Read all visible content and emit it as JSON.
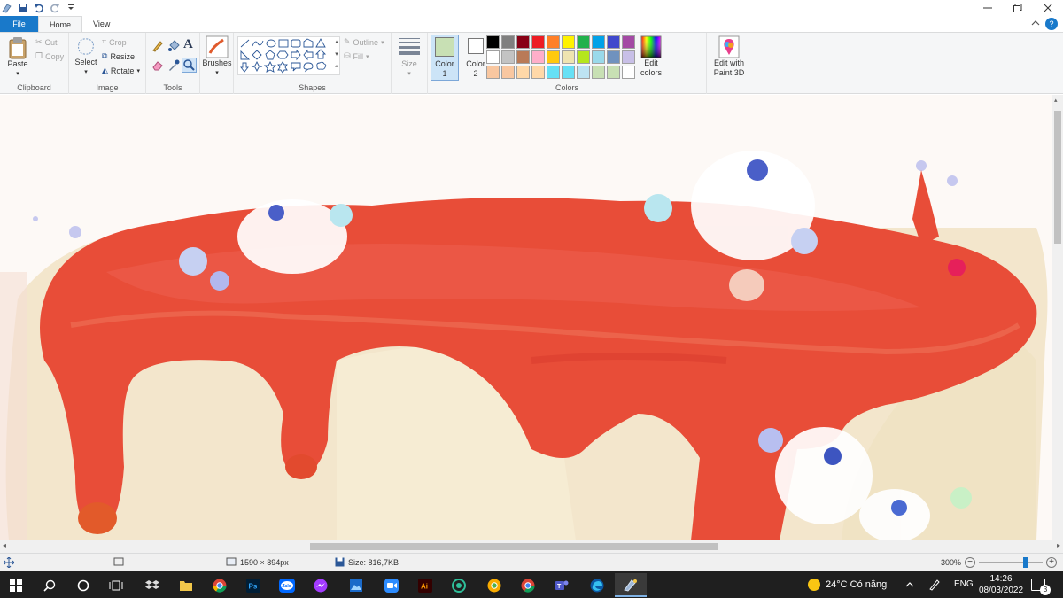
{
  "tabs": {
    "file": "File",
    "home": "Home",
    "view": "View"
  },
  "help_label": "?",
  "clipboard": {
    "paste": "Paste",
    "cut": "Cut",
    "copy": "Copy",
    "label": "Clipboard"
  },
  "image": {
    "select": "Select",
    "crop": "Crop",
    "resize": "Resize",
    "rotate": "Rotate",
    "label": "Image"
  },
  "tools": {
    "label": "Tools",
    "text_tool": "A"
  },
  "brushes": {
    "label": "Brushes"
  },
  "shapes": {
    "outline": "Outline",
    "fill": "Fill",
    "label": "Shapes"
  },
  "size": {
    "label": "Size"
  },
  "colors": {
    "color1": "Color 1",
    "color2": "Color 2",
    "edit_colors": "Edit colors",
    "paint3d": "Edit with Paint 3D",
    "label": "Colors",
    "color1_value": "#c8e0b4",
    "color2_value": "#ffffff",
    "palette_row1": [
      "#000000",
      "#7f7f7f",
      "#880015",
      "#ed1c24",
      "#ff7f27",
      "#fff200",
      "#22b14c",
      "#00a2e8",
      "#3f48cc",
      "#a349a4"
    ],
    "palette_row2": [
      "#ffffff",
      "#c3c3c3",
      "#b97a57",
      "#ffaec9",
      "#ffc90e",
      "#efe4b0",
      "#b5e61d",
      "#99d9ea",
      "#7092be",
      "#c8bfe7"
    ],
    "palette_row3": [
      "#f9c7a0",
      "#f9c7a0",
      "#ffd8a8",
      "#ffd8a8",
      "#66e0f5",
      "#66e0f5",
      "#bde3f2",
      "#c8e0b4",
      "#c8e0b4",
      ""
    ]
  },
  "status": {
    "dimensions": "1590 × 894px",
    "size": "Size: 816,7KB",
    "zoom": "300%",
    "zoom_level": 0.75
  },
  "taskbar": {
    "weather": "24°C  Có nắng",
    "lang": "ENG",
    "time": "14:26",
    "date": "08/03/2022",
    "notifications": "3",
    "apps": [
      "start",
      "search",
      "cortana",
      "task-view",
      "dropbox",
      "file-explorer",
      "chrome",
      "photoshop",
      "zalo",
      "messenger",
      "photos",
      "zoom",
      "illustrator",
      "edge-dev",
      "chrome-canary",
      "chrome-2",
      "teams",
      "edge",
      "paint"
    ]
  }
}
